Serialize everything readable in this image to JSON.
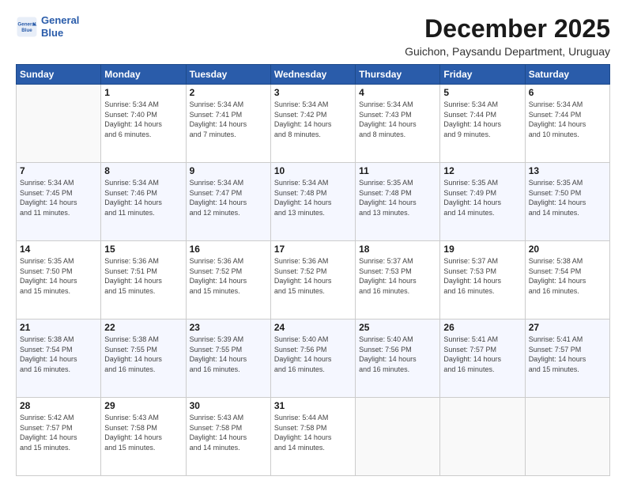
{
  "logo": {
    "line1": "General",
    "line2": "Blue"
  },
  "title": "December 2025",
  "subtitle": "Guichon, Paysandu Department, Uruguay",
  "header_days": [
    "Sunday",
    "Monday",
    "Tuesday",
    "Wednesday",
    "Thursday",
    "Friday",
    "Saturday"
  ],
  "weeks": [
    [
      {
        "day": "",
        "info": ""
      },
      {
        "day": "1",
        "info": "Sunrise: 5:34 AM\nSunset: 7:40 PM\nDaylight: 14 hours\nand 6 minutes."
      },
      {
        "day": "2",
        "info": "Sunrise: 5:34 AM\nSunset: 7:41 PM\nDaylight: 14 hours\nand 7 minutes."
      },
      {
        "day": "3",
        "info": "Sunrise: 5:34 AM\nSunset: 7:42 PM\nDaylight: 14 hours\nand 8 minutes."
      },
      {
        "day": "4",
        "info": "Sunrise: 5:34 AM\nSunset: 7:43 PM\nDaylight: 14 hours\nand 8 minutes."
      },
      {
        "day": "5",
        "info": "Sunrise: 5:34 AM\nSunset: 7:44 PM\nDaylight: 14 hours\nand 9 minutes."
      },
      {
        "day": "6",
        "info": "Sunrise: 5:34 AM\nSunset: 7:44 PM\nDaylight: 14 hours\nand 10 minutes."
      }
    ],
    [
      {
        "day": "7",
        "info": "Sunrise: 5:34 AM\nSunset: 7:45 PM\nDaylight: 14 hours\nand 11 minutes."
      },
      {
        "day": "8",
        "info": "Sunrise: 5:34 AM\nSunset: 7:46 PM\nDaylight: 14 hours\nand 11 minutes."
      },
      {
        "day": "9",
        "info": "Sunrise: 5:34 AM\nSunset: 7:47 PM\nDaylight: 14 hours\nand 12 minutes."
      },
      {
        "day": "10",
        "info": "Sunrise: 5:34 AM\nSunset: 7:48 PM\nDaylight: 14 hours\nand 13 minutes."
      },
      {
        "day": "11",
        "info": "Sunrise: 5:35 AM\nSunset: 7:48 PM\nDaylight: 14 hours\nand 13 minutes."
      },
      {
        "day": "12",
        "info": "Sunrise: 5:35 AM\nSunset: 7:49 PM\nDaylight: 14 hours\nand 14 minutes."
      },
      {
        "day": "13",
        "info": "Sunrise: 5:35 AM\nSunset: 7:50 PM\nDaylight: 14 hours\nand 14 minutes."
      }
    ],
    [
      {
        "day": "14",
        "info": "Sunrise: 5:35 AM\nSunset: 7:50 PM\nDaylight: 14 hours\nand 15 minutes."
      },
      {
        "day": "15",
        "info": "Sunrise: 5:36 AM\nSunset: 7:51 PM\nDaylight: 14 hours\nand 15 minutes."
      },
      {
        "day": "16",
        "info": "Sunrise: 5:36 AM\nSunset: 7:52 PM\nDaylight: 14 hours\nand 15 minutes."
      },
      {
        "day": "17",
        "info": "Sunrise: 5:36 AM\nSunset: 7:52 PM\nDaylight: 14 hours\nand 15 minutes."
      },
      {
        "day": "18",
        "info": "Sunrise: 5:37 AM\nSunset: 7:53 PM\nDaylight: 14 hours\nand 16 minutes."
      },
      {
        "day": "19",
        "info": "Sunrise: 5:37 AM\nSunset: 7:53 PM\nDaylight: 14 hours\nand 16 minutes."
      },
      {
        "day": "20",
        "info": "Sunrise: 5:38 AM\nSunset: 7:54 PM\nDaylight: 14 hours\nand 16 minutes."
      }
    ],
    [
      {
        "day": "21",
        "info": "Sunrise: 5:38 AM\nSunset: 7:54 PM\nDaylight: 14 hours\nand 16 minutes."
      },
      {
        "day": "22",
        "info": "Sunrise: 5:38 AM\nSunset: 7:55 PM\nDaylight: 14 hours\nand 16 minutes."
      },
      {
        "day": "23",
        "info": "Sunrise: 5:39 AM\nSunset: 7:55 PM\nDaylight: 14 hours\nand 16 minutes."
      },
      {
        "day": "24",
        "info": "Sunrise: 5:40 AM\nSunset: 7:56 PM\nDaylight: 14 hours\nand 16 minutes."
      },
      {
        "day": "25",
        "info": "Sunrise: 5:40 AM\nSunset: 7:56 PM\nDaylight: 14 hours\nand 16 minutes."
      },
      {
        "day": "26",
        "info": "Sunrise: 5:41 AM\nSunset: 7:57 PM\nDaylight: 14 hours\nand 16 minutes."
      },
      {
        "day": "27",
        "info": "Sunrise: 5:41 AM\nSunset: 7:57 PM\nDaylight: 14 hours\nand 15 minutes."
      }
    ],
    [
      {
        "day": "28",
        "info": "Sunrise: 5:42 AM\nSunset: 7:57 PM\nDaylight: 14 hours\nand 15 minutes."
      },
      {
        "day": "29",
        "info": "Sunrise: 5:43 AM\nSunset: 7:58 PM\nDaylight: 14 hours\nand 15 minutes."
      },
      {
        "day": "30",
        "info": "Sunrise: 5:43 AM\nSunset: 7:58 PM\nDaylight: 14 hours\nand 14 minutes."
      },
      {
        "day": "31",
        "info": "Sunrise: 5:44 AM\nSunset: 7:58 PM\nDaylight: 14 hours\nand 14 minutes."
      },
      {
        "day": "",
        "info": ""
      },
      {
        "day": "",
        "info": ""
      },
      {
        "day": "",
        "info": ""
      }
    ]
  ]
}
